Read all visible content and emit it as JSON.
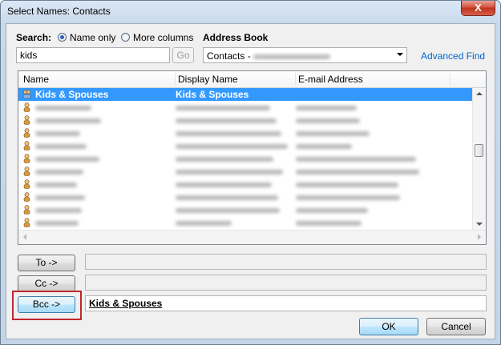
{
  "window": {
    "title": "Select Names: Contacts",
    "close_label": "X"
  },
  "search": {
    "label": "Search:",
    "option_name_only": "Name only",
    "option_more_columns": "More columns",
    "query": "kids",
    "go_label": "Go"
  },
  "address_book": {
    "label": "Address Book",
    "selected": "Contacts - ",
    "advanced_find": "Advanced Find"
  },
  "columns": {
    "name": "Name",
    "display_name": "Display Name",
    "email": "E-mail Address"
  },
  "selected_row": {
    "name": "Kids & Spouses",
    "display_name": "Kids & Spouses"
  },
  "recipients": {
    "to_label": "To ->",
    "cc_label": "Cc ->",
    "bcc_label": "Bcc ->",
    "bcc_value": "Kids & Spouses"
  },
  "buttons": {
    "ok": "OK",
    "cancel": "Cancel"
  },
  "colors": {
    "selection": "#3399ff",
    "highlight": "#c0272d",
    "link": "#0066cc"
  }
}
